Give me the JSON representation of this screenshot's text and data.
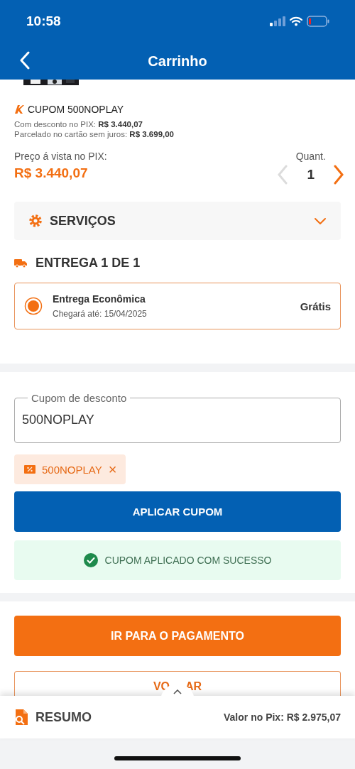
{
  "status_bar": {
    "time": "10:58"
  },
  "nav": {
    "title": "Carrinho"
  },
  "product": {
    "kind": "picture",
    "coupon": "CUPOM 500NOPLAY",
    "pix_label": "Com desconto no PIX: ",
    "pix_value": "R$ 3.440,07",
    "card_label": "Parcelado no cartão sem juros: ",
    "card_value": "R$ 3.699,00",
    "price_label": "Preço á vista no PIX:",
    "price": "R$ 3.440,07",
    "qty_label": "Quant.",
    "qty": "1",
    "decrease_disabled": true
  },
  "services": {
    "title": "SERVIÇOS",
    "expanded": false
  },
  "delivery": {
    "title": "ENTREGA 1 DE 1",
    "options": [
      {
        "name": "Entrega Econômica",
        "eta": "Chegará até: 15/04/2025",
        "price": "Grátis",
        "selected": true
      }
    ]
  },
  "coupon": {
    "label": "Cupom de desconto",
    "value": "500NOPLAY",
    "chip": "500NOPLAY",
    "chip_close": "×",
    "apply": "APLICAR CUPOM",
    "message": "CUPOM APLICADO COM SUCESSO"
  },
  "actions": {
    "pay": "IR PARA O PAGAMENTO",
    "back_visible": [
      "VO",
      "AR"
    ]
  },
  "summary": {
    "title": "RESUMO",
    "total": "Valor no Pix: R$ 2.975,07",
    "expanded": false
  }
}
